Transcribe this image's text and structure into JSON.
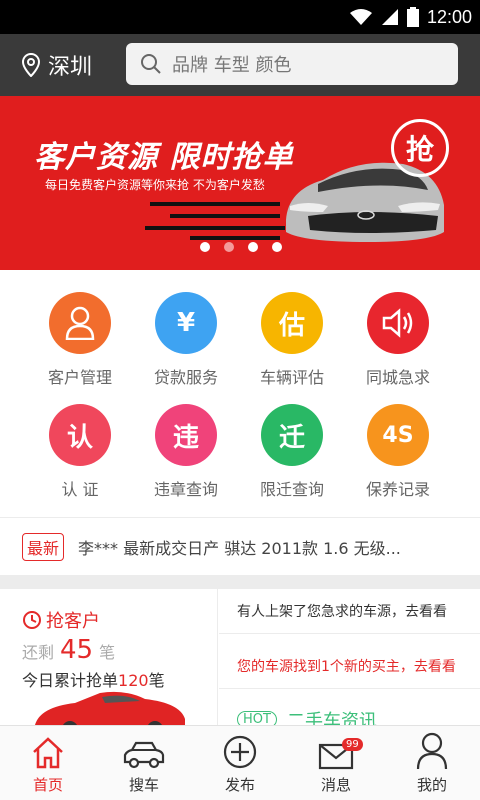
{
  "status_bar": {
    "time": "12:00"
  },
  "header": {
    "city": "深圳",
    "search_placeholder": "品牌 车型 颜色"
  },
  "banner": {
    "title": "客户资源 限时抢单",
    "subtitle": "每日免费客户资源等你来抢 不为客户发愁",
    "grab_label": "抢",
    "slide_count": 4,
    "active_slide": 2
  },
  "grid": [
    {
      "label": "客户管理",
      "icon": "person-icon",
      "glyph": "",
      "color": "#f26d2d"
    },
    {
      "label": "贷款服务",
      "icon": "yen-icon",
      "glyph": "¥",
      "color": "#3ea3f2"
    },
    {
      "label": "车辆评估",
      "icon": "estimate-icon",
      "glyph": "估",
      "color": "#f7b500"
    },
    {
      "label": "同城急求",
      "icon": "speaker-icon",
      "glyph": "",
      "color": "#e8262e"
    },
    {
      "label": "认 证",
      "icon": "certify-icon",
      "glyph": "认",
      "color": "#f0475c"
    },
    {
      "label": "违章查询",
      "icon": "violation-icon",
      "glyph": "违",
      "color": "#f0437a"
    },
    {
      "label": "限迁查询",
      "icon": "transfer-icon",
      "glyph": "迁",
      "color": "#29b865"
    },
    {
      "label": "保养记录",
      "icon": "4s-icon",
      "glyph": "4S",
      "color": "#f7941d"
    }
  ],
  "ticker": {
    "badge": "最新",
    "text": "李***  最新成交日产 骐达 2011款 1.6 无级..."
  },
  "grab_card": {
    "title": "抢客户",
    "remain_prefix": "还剩",
    "remain_count": "45",
    "remain_unit": "笔",
    "today_prefix": "今日累计抢单",
    "today_count": "120",
    "today_unit": "笔"
  },
  "info_rows": [
    {
      "text": "有人上架了您急求的车源，去看看",
      "color": "#333333"
    },
    {
      "text": "您的车源找到1个新的买主，去看看",
      "color": "#e42a2a"
    },
    {
      "badge": "HOT",
      "text": "二手车资讯",
      "color": "#3cbf7a"
    }
  ],
  "tabs": [
    {
      "label": "首页",
      "icon": "home-icon",
      "active": true
    },
    {
      "label": "搜车",
      "icon": "car-icon",
      "active": false
    },
    {
      "label": "发布",
      "icon": "plus-circle-icon",
      "active": false
    },
    {
      "label": "消息",
      "icon": "mail-icon",
      "active": false,
      "badge": "99"
    },
    {
      "label": "我的",
      "icon": "user-icon",
      "active": false
    }
  ]
}
